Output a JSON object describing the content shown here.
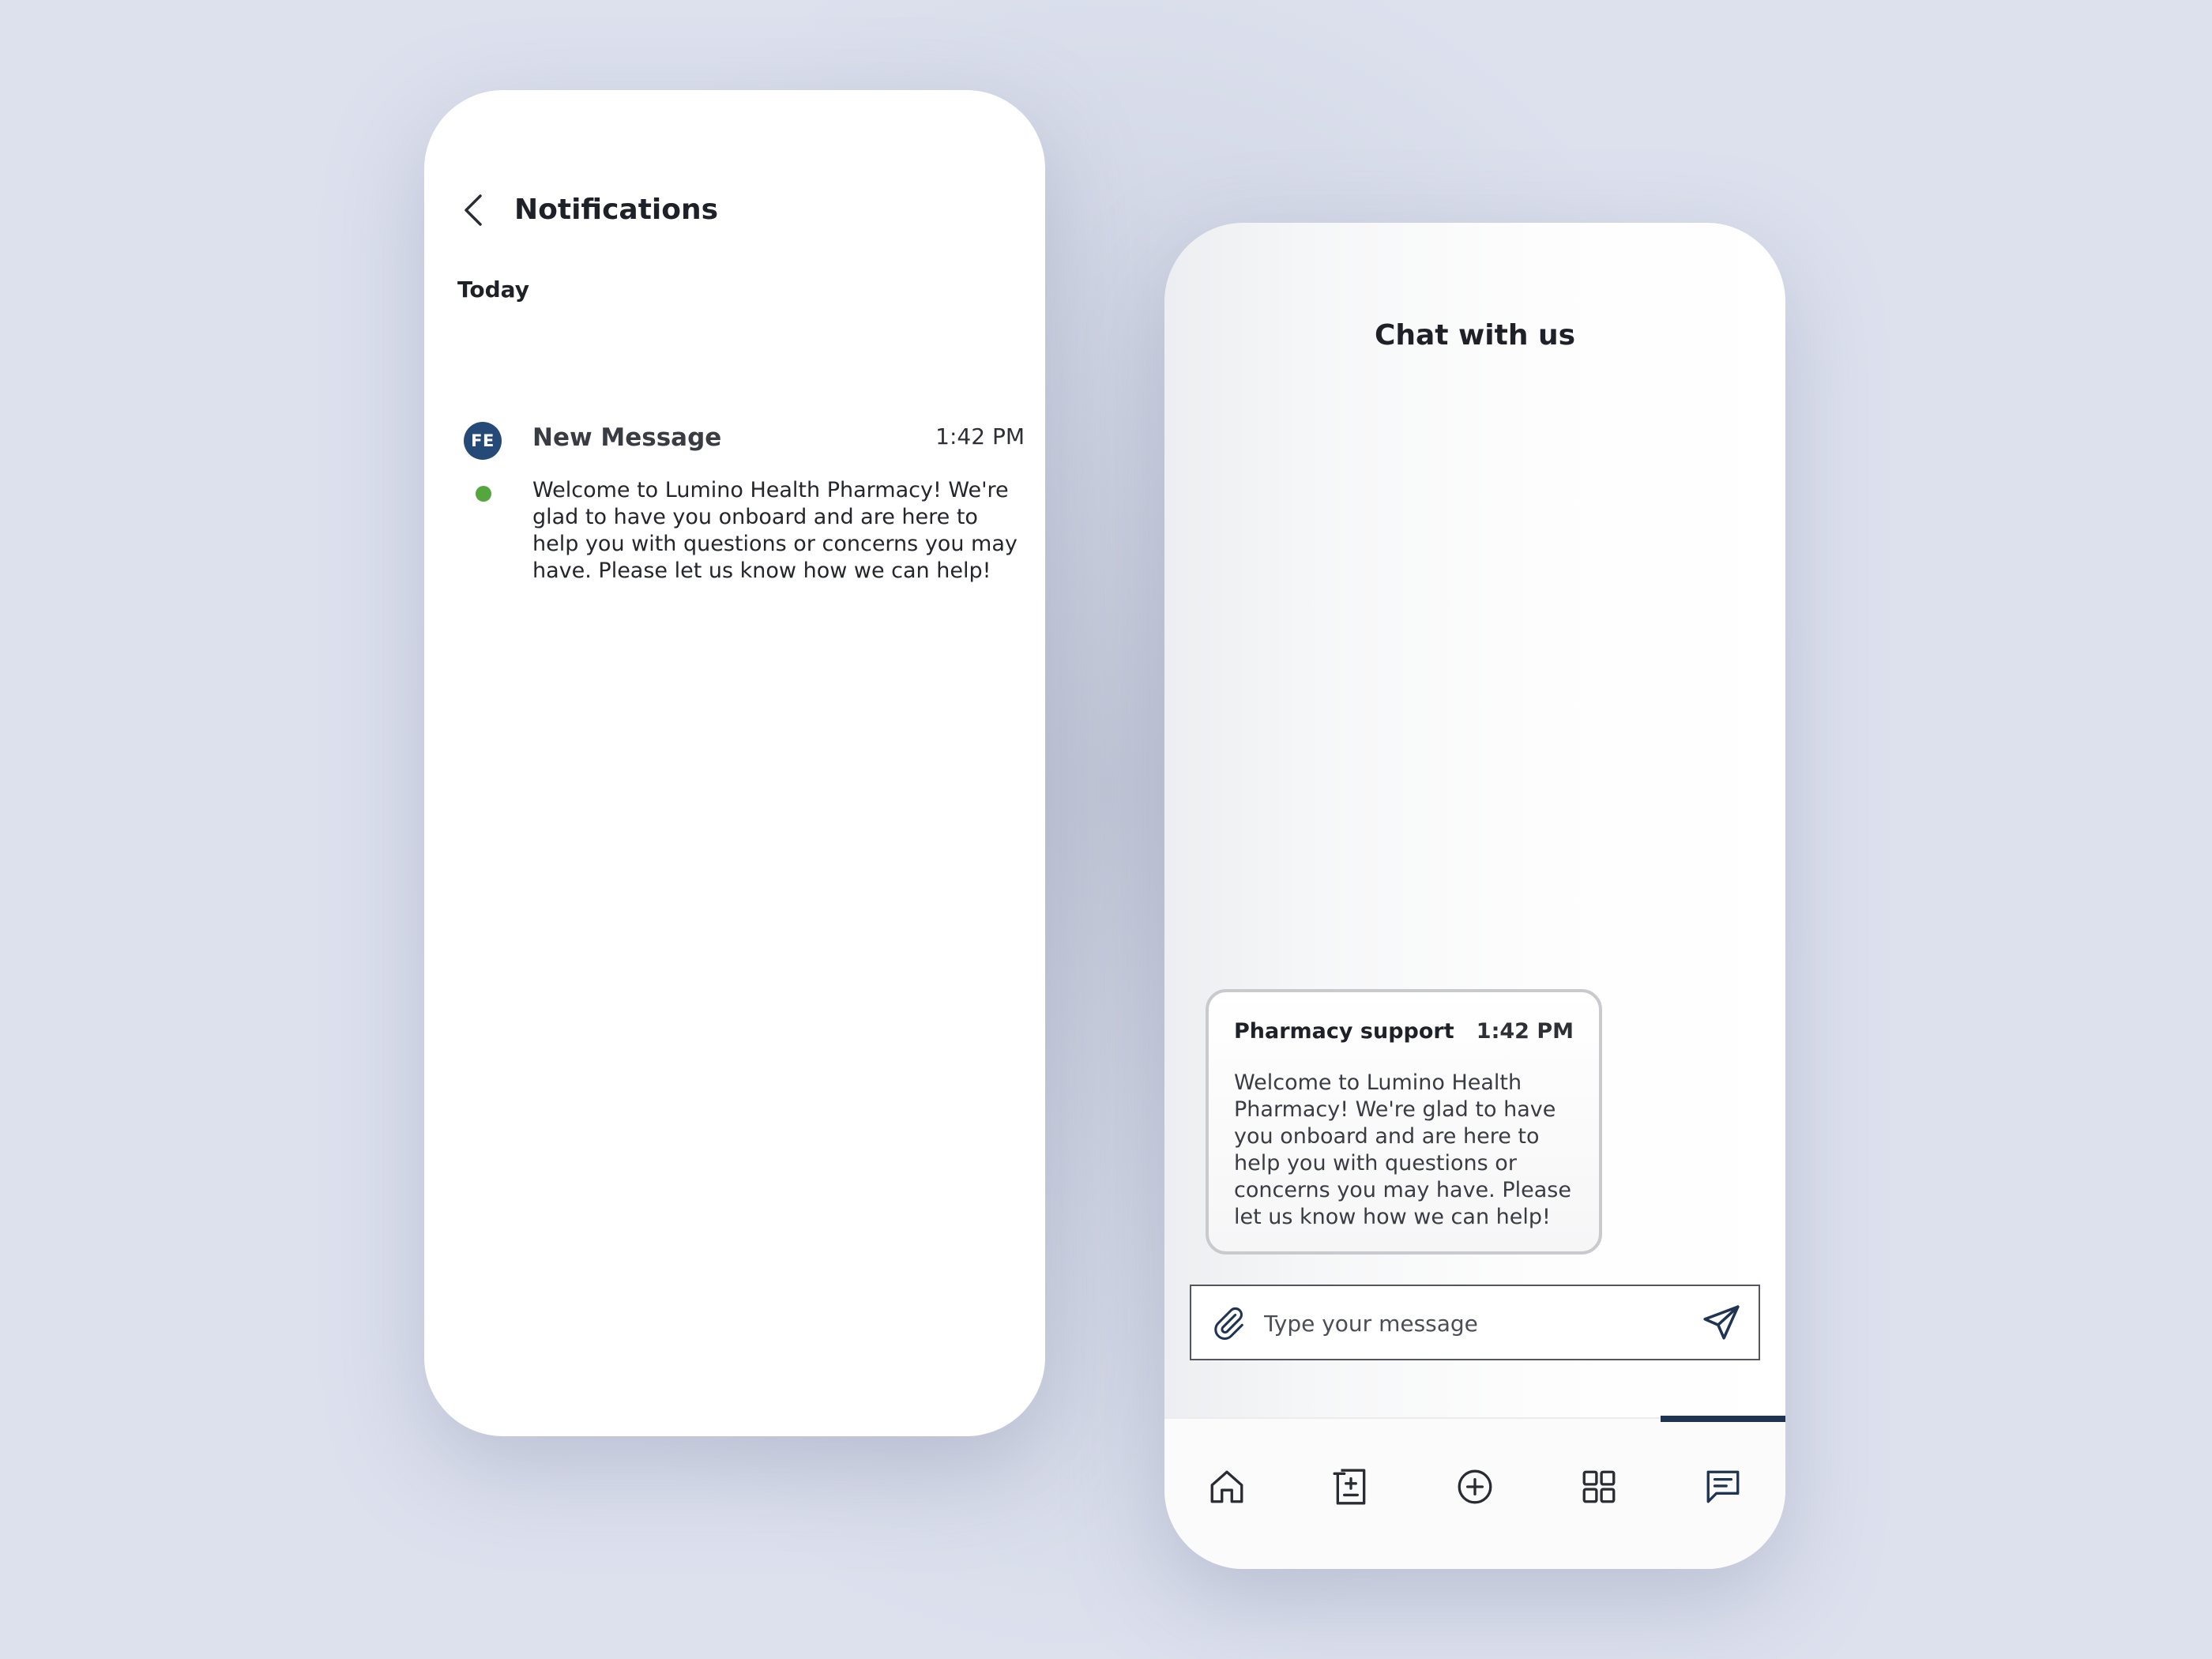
{
  "notifications_screen": {
    "title": "Notifications",
    "section_label": "Today",
    "items": [
      {
        "avatar_initials": "FE",
        "title": "New Message",
        "time": "1:42 PM",
        "body": "Welcome to Lumino Health Pharmacy! We're glad to have you onboard and are here to help you with questions or concerns you may have. Please let us know how we can help!",
        "unread": true
      }
    ]
  },
  "chat_screen": {
    "title": "Chat with us",
    "messages": [
      {
        "sender": "Pharmacy support",
        "time": "1:42 PM",
        "body": "Welcome to Lumino Health Pharmacy! We're glad to have you onboard and are here to help you with questions or concerns you may have. Please let us know how we can help!"
      }
    ],
    "composer": {
      "placeholder": "Type your message",
      "value": ""
    },
    "nav": {
      "items": [
        {
          "icon": "home-icon"
        },
        {
          "icon": "prescription-icon"
        },
        {
          "icon": "add-circle-icon"
        },
        {
          "icon": "grid-icon"
        },
        {
          "icon": "chat-icon",
          "active": true
        }
      ]
    }
  },
  "colors": {
    "avatar": "#264a77",
    "unread_dot": "#54a73f",
    "nav_active": "#1f3452",
    "icon_accent": "#1f3452"
  }
}
